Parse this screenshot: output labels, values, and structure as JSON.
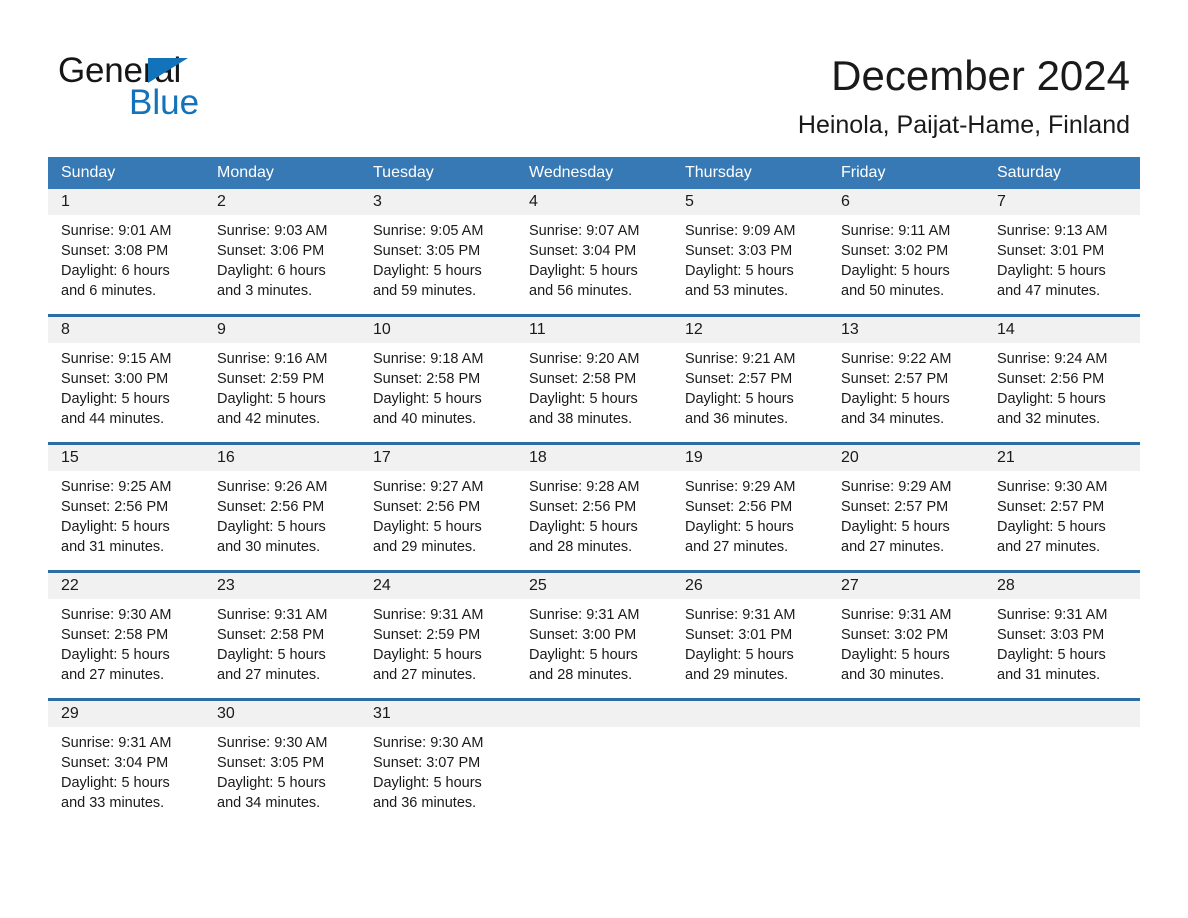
{
  "brand": {
    "name_part1": "General",
    "name_part2": "Blue",
    "triangle_icon": "triangle-icon",
    "accent_color": "#1373ba"
  },
  "header": {
    "title": "December 2024",
    "subtitle": "Heinola, Paijat-Hame, Finland"
  },
  "calendar": {
    "header_bg": "#3679b5",
    "row_divider_color": "#2e6da4",
    "daynum_bg": "#f1f1f1",
    "weekdays": [
      "Sunday",
      "Monday",
      "Tuesday",
      "Wednesday",
      "Thursday",
      "Friday",
      "Saturday"
    ],
    "weeks": [
      [
        {
          "day": "1",
          "sunrise": "Sunrise: 9:01 AM",
          "sunset": "Sunset: 3:08 PM",
          "daylight1": "Daylight: 6 hours",
          "daylight2": "and 6 minutes."
        },
        {
          "day": "2",
          "sunrise": "Sunrise: 9:03 AM",
          "sunset": "Sunset: 3:06 PM",
          "daylight1": "Daylight: 6 hours",
          "daylight2": "and 3 minutes."
        },
        {
          "day": "3",
          "sunrise": "Sunrise: 9:05 AM",
          "sunset": "Sunset: 3:05 PM",
          "daylight1": "Daylight: 5 hours",
          "daylight2": "and 59 minutes."
        },
        {
          "day": "4",
          "sunrise": "Sunrise: 9:07 AM",
          "sunset": "Sunset: 3:04 PM",
          "daylight1": "Daylight: 5 hours",
          "daylight2": "and 56 minutes."
        },
        {
          "day": "5",
          "sunrise": "Sunrise: 9:09 AM",
          "sunset": "Sunset: 3:03 PM",
          "daylight1": "Daylight: 5 hours",
          "daylight2": "and 53 minutes."
        },
        {
          "day": "6",
          "sunrise": "Sunrise: 9:11 AM",
          "sunset": "Sunset: 3:02 PM",
          "daylight1": "Daylight: 5 hours",
          "daylight2": "and 50 minutes."
        },
        {
          "day": "7",
          "sunrise": "Sunrise: 9:13 AM",
          "sunset": "Sunset: 3:01 PM",
          "daylight1": "Daylight: 5 hours",
          "daylight2": "and 47 minutes."
        }
      ],
      [
        {
          "day": "8",
          "sunrise": "Sunrise: 9:15 AM",
          "sunset": "Sunset: 3:00 PM",
          "daylight1": "Daylight: 5 hours",
          "daylight2": "and 44 minutes."
        },
        {
          "day": "9",
          "sunrise": "Sunrise: 9:16 AM",
          "sunset": "Sunset: 2:59 PM",
          "daylight1": "Daylight: 5 hours",
          "daylight2": "and 42 minutes."
        },
        {
          "day": "10",
          "sunrise": "Sunrise: 9:18 AM",
          "sunset": "Sunset: 2:58 PM",
          "daylight1": "Daylight: 5 hours",
          "daylight2": "and 40 minutes."
        },
        {
          "day": "11",
          "sunrise": "Sunrise: 9:20 AM",
          "sunset": "Sunset: 2:58 PM",
          "daylight1": "Daylight: 5 hours",
          "daylight2": "and 38 minutes."
        },
        {
          "day": "12",
          "sunrise": "Sunrise: 9:21 AM",
          "sunset": "Sunset: 2:57 PM",
          "daylight1": "Daylight: 5 hours",
          "daylight2": "and 36 minutes."
        },
        {
          "day": "13",
          "sunrise": "Sunrise: 9:22 AM",
          "sunset": "Sunset: 2:57 PM",
          "daylight1": "Daylight: 5 hours",
          "daylight2": "and 34 minutes."
        },
        {
          "day": "14",
          "sunrise": "Sunrise: 9:24 AM",
          "sunset": "Sunset: 2:56 PM",
          "daylight1": "Daylight: 5 hours",
          "daylight2": "and 32 minutes."
        }
      ],
      [
        {
          "day": "15",
          "sunrise": "Sunrise: 9:25 AM",
          "sunset": "Sunset: 2:56 PM",
          "daylight1": "Daylight: 5 hours",
          "daylight2": "and 31 minutes."
        },
        {
          "day": "16",
          "sunrise": "Sunrise: 9:26 AM",
          "sunset": "Sunset: 2:56 PM",
          "daylight1": "Daylight: 5 hours",
          "daylight2": "and 30 minutes."
        },
        {
          "day": "17",
          "sunrise": "Sunrise: 9:27 AM",
          "sunset": "Sunset: 2:56 PM",
          "daylight1": "Daylight: 5 hours",
          "daylight2": "and 29 minutes."
        },
        {
          "day": "18",
          "sunrise": "Sunrise: 9:28 AM",
          "sunset": "Sunset: 2:56 PM",
          "daylight1": "Daylight: 5 hours",
          "daylight2": "and 28 minutes."
        },
        {
          "day": "19",
          "sunrise": "Sunrise: 9:29 AM",
          "sunset": "Sunset: 2:56 PM",
          "daylight1": "Daylight: 5 hours",
          "daylight2": "and 27 minutes."
        },
        {
          "day": "20",
          "sunrise": "Sunrise: 9:29 AM",
          "sunset": "Sunset: 2:57 PM",
          "daylight1": "Daylight: 5 hours",
          "daylight2": "and 27 minutes."
        },
        {
          "day": "21",
          "sunrise": "Sunrise: 9:30 AM",
          "sunset": "Sunset: 2:57 PM",
          "daylight1": "Daylight: 5 hours",
          "daylight2": "and 27 minutes."
        }
      ],
      [
        {
          "day": "22",
          "sunrise": "Sunrise: 9:30 AM",
          "sunset": "Sunset: 2:58 PM",
          "daylight1": "Daylight: 5 hours",
          "daylight2": "and 27 minutes."
        },
        {
          "day": "23",
          "sunrise": "Sunrise: 9:31 AM",
          "sunset": "Sunset: 2:58 PM",
          "daylight1": "Daylight: 5 hours",
          "daylight2": "and 27 minutes."
        },
        {
          "day": "24",
          "sunrise": "Sunrise: 9:31 AM",
          "sunset": "Sunset: 2:59 PM",
          "daylight1": "Daylight: 5 hours",
          "daylight2": "and 27 minutes."
        },
        {
          "day": "25",
          "sunrise": "Sunrise: 9:31 AM",
          "sunset": "Sunset: 3:00 PM",
          "daylight1": "Daylight: 5 hours",
          "daylight2": "and 28 minutes."
        },
        {
          "day": "26",
          "sunrise": "Sunrise: 9:31 AM",
          "sunset": "Sunset: 3:01 PM",
          "daylight1": "Daylight: 5 hours",
          "daylight2": "and 29 minutes."
        },
        {
          "day": "27",
          "sunrise": "Sunrise: 9:31 AM",
          "sunset": "Sunset: 3:02 PM",
          "daylight1": "Daylight: 5 hours",
          "daylight2": "and 30 minutes."
        },
        {
          "day": "28",
          "sunrise": "Sunrise: 9:31 AM",
          "sunset": "Sunset: 3:03 PM",
          "daylight1": "Daylight: 5 hours",
          "daylight2": "and 31 minutes."
        }
      ],
      [
        {
          "day": "29",
          "sunrise": "Sunrise: 9:31 AM",
          "sunset": "Sunset: 3:04 PM",
          "daylight1": "Daylight: 5 hours",
          "daylight2": "and 33 minutes."
        },
        {
          "day": "30",
          "sunrise": "Sunrise: 9:30 AM",
          "sunset": "Sunset: 3:05 PM",
          "daylight1": "Daylight: 5 hours",
          "daylight2": "and 34 minutes."
        },
        {
          "day": "31",
          "sunrise": "Sunrise: 9:30 AM",
          "sunset": "Sunset: 3:07 PM",
          "daylight1": "Daylight: 5 hours",
          "daylight2": "and 36 minutes."
        },
        {
          "day": "",
          "sunrise": "",
          "sunset": "",
          "daylight1": "",
          "daylight2": ""
        },
        {
          "day": "",
          "sunrise": "",
          "sunset": "",
          "daylight1": "",
          "daylight2": ""
        },
        {
          "day": "",
          "sunrise": "",
          "sunset": "",
          "daylight1": "",
          "daylight2": ""
        },
        {
          "day": "",
          "sunrise": "",
          "sunset": "",
          "daylight1": "",
          "daylight2": ""
        }
      ]
    ]
  }
}
